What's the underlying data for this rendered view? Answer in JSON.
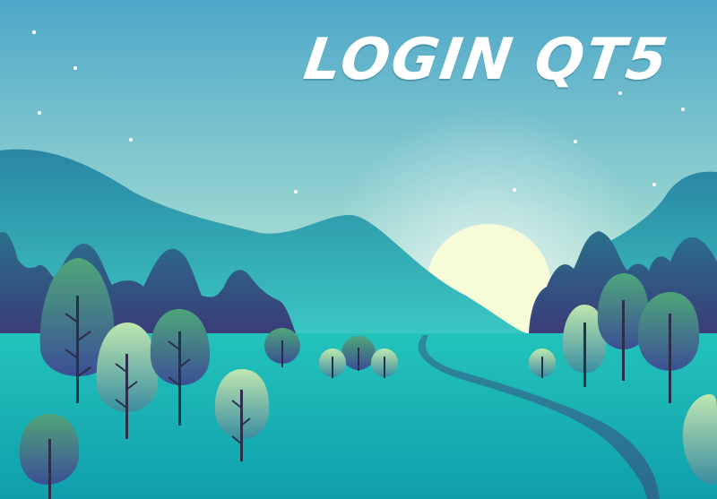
{
  "window": {
    "title": "LOGIN QT5"
  },
  "scene": {
    "description_icon": "landscape-illustration",
    "colors": {
      "sky_top": "#4ea7c9",
      "sky_bottom": "#c4ead2",
      "sun": "#f6fbd8",
      "mountain_back": "#2f8fa4",
      "mountain_dark": "#3a3a75",
      "lake": "#17b0b1",
      "river": "#2a7a94",
      "tree_top": "#4ea67a",
      "tree_bottom": "#3b4f95"
    }
  }
}
